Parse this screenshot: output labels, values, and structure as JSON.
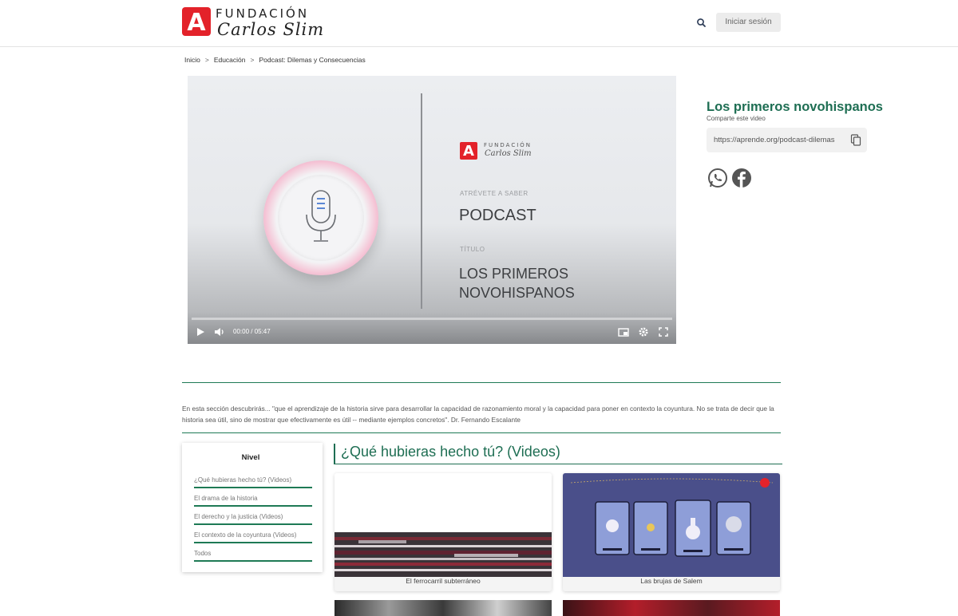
{
  "header": {
    "logo_letter": "A",
    "logo_word": "FUNDACIÓN",
    "logo_script": "Carlos Slim",
    "login_label": "Iniciar sesión",
    "search_icon": "search-icon"
  },
  "breadcrumb": {
    "items": [
      "Inicio",
      "Educación",
      "Podcast: Dilemas y Consecuencias"
    ],
    "separator": ">"
  },
  "player": {
    "logo_word": "FUNDACIÓN",
    "logo_script": "Carlos Slim",
    "tagline": "ATRÉVETE A SABER",
    "type": "PODCAST",
    "title_label": "TÍTULO",
    "title_line1": "LOS PRIMEROS",
    "title_line2": "NOVOHISPANOS",
    "time": "00:00 / 05:47",
    "progress": 0
  },
  "side": {
    "title": "Los primeros novohispanos",
    "share_label": "Comparte este video",
    "share_url": "https://aprende.org/podcast-dilemas"
  },
  "description": "En esta sección descubrirás... \"que el aprendizaje de la historia sirve para desarrollar la capacidad de razonamiento moral y la capacidad para poner en contexto la coyuntura. No se trata de decir que la historia sea útil, sino de mostrar que efectivamente es útil -- mediante ejemplos concretos\". Dr. Fernando Escalante",
  "nivel": {
    "title": "Nivel",
    "items": [
      "¿Qué hubieras hecho tú? (Videos)",
      "El drama de la historia",
      "El derecho y la justicia (Videos)",
      "El contexto de la coyuntura (Videos)",
      "Todos"
    ]
  },
  "section": {
    "heading": "¿Qué hubieras hecho tú? (Videos)",
    "cards": [
      {
        "caption": "El ferrocarril subterráneo"
      },
      {
        "caption": "Las brujas de Salem"
      }
    ]
  },
  "colors": {
    "accent_green": "#1e6e53",
    "brand_red": "#e3222a"
  }
}
